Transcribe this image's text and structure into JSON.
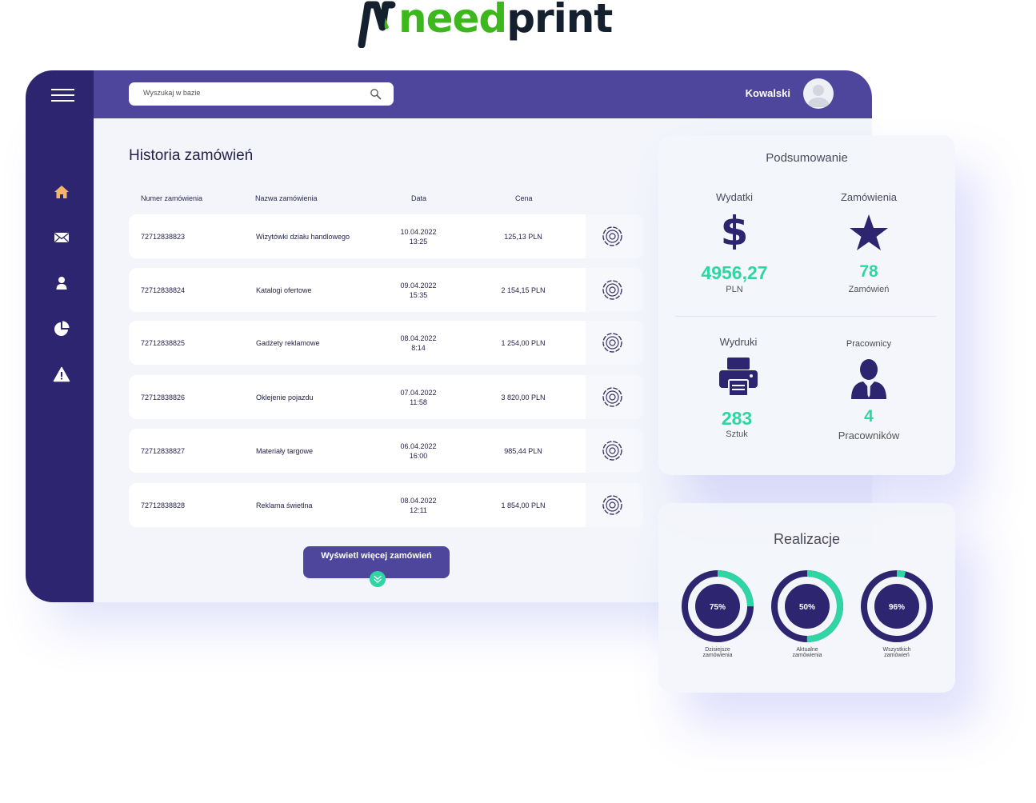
{
  "brand": {
    "logo_part1": "need",
    "logo_part2": "print",
    "color_green": "#3cb81d",
    "color_dark": "#15202e"
  },
  "colors": {
    "sidebar": "#2e2570",
    "topbar": "#4d469c",
    "accent": "#2fd6a4",
    "home_icon": "#f4b56a"
  },
  "sidebar": {
    "items": [
      {
        "icon": "home-icon"
      },
      {
        "icon": "mail-icon"
      },
      {
        "icon": "user-icon"
      },
      {
        "icon": "pie-chart-icon"
      },
      {
        "icon": "warning-icon"
      }
    ]
  },
  "header": {
    "search_placeholder": "Wyszukaj w bazie",
    "username": "Kowalski"
  },
  "orders": {
    "title": "Historia zamówień",
    "columns": [
      "Numer zamówienia",
      "Nazwa zamówienia",
      "Data",
      "Cena"
    ],
    "rows": [
      {
        "number": "72712838823",
        "name": "Wizytówki działu handlowego",
        "date": "10.04.2022",
        "time": "13:25",
        "price": "125,13 PLN"
      },
      {
        "number": "72712838824",
        "name": "Katalogi ofertowe",
        "date": "09.04.2022",
        "time": "15:35",
        "price": "2 154,15 PLN"
      },
      {
        "number": "72712838825",
        "name": "Gadżety reklamowe",
        "date": "08.04.2022",
        "time": "8:14",
        "price": "1 254,00 PLN"
      },
      {
        "number": "72712838826",
        "name": "Oklejenie pojazdu",
        "date": "07.04.2022",
        "time": "11:58",
        "price": "3 820,00 PLN"
      },
      {
        "number": "72712838827",
        "name": "Materiały targowe",
        "date": "06.04.2022",
        "time": "16:00",
        "price": "985,44 PLN"
      },
      {
        "number": "72712838828",
        "name": "Reklama świetlna",
        "date": "08.04.2022",
        "time": "12:11",
        "price": "1 854,00 PLN"
      }
    ],
    "more_label": "Wyświetl więcej zamówień"
  },
  "summary": {
    "title": "Podsumowanie",
    "expenses": {
      "label": "Wydatki",
      "value": "4956,27",
      "unit": "PLN",
      "icon": "dollar-icon"
    },
    "orders": {
      "label": "Zamówienia",
      "value": "78",
      "unit": "Zamówień",
      "icon": "star-icon"
    },
    "prints": {
      "label": "Wydruki",
      "value": "283",
      "unit": "Sztuk",
      "icon": "printer-icon"
    },
    "employees": {
      "label": "Pracownicy",
      "value": "4",
      "unit": "Pracowników",
      "icon": "employee-icon"
    }
  },
  "realization": {
    "title": "Realizacje",
    "items": [
      {
        "percent": 75,
        "percent_label": "75%",
        "label_line1": "Dzisiejsze",
        "label_line2": "zamówienia"
      },
      {
        "percent": 50,
        "percent_label": "50%",
        "label_line1": "Aktualne",
        "label_line2": "zamówienia"
      },
      {
        "percent": 96,
        "percent_label": "96%",
        "label_line1": "Wszystkich",
        "label_line2": "zamówień"
      }
    ]
  }
}
